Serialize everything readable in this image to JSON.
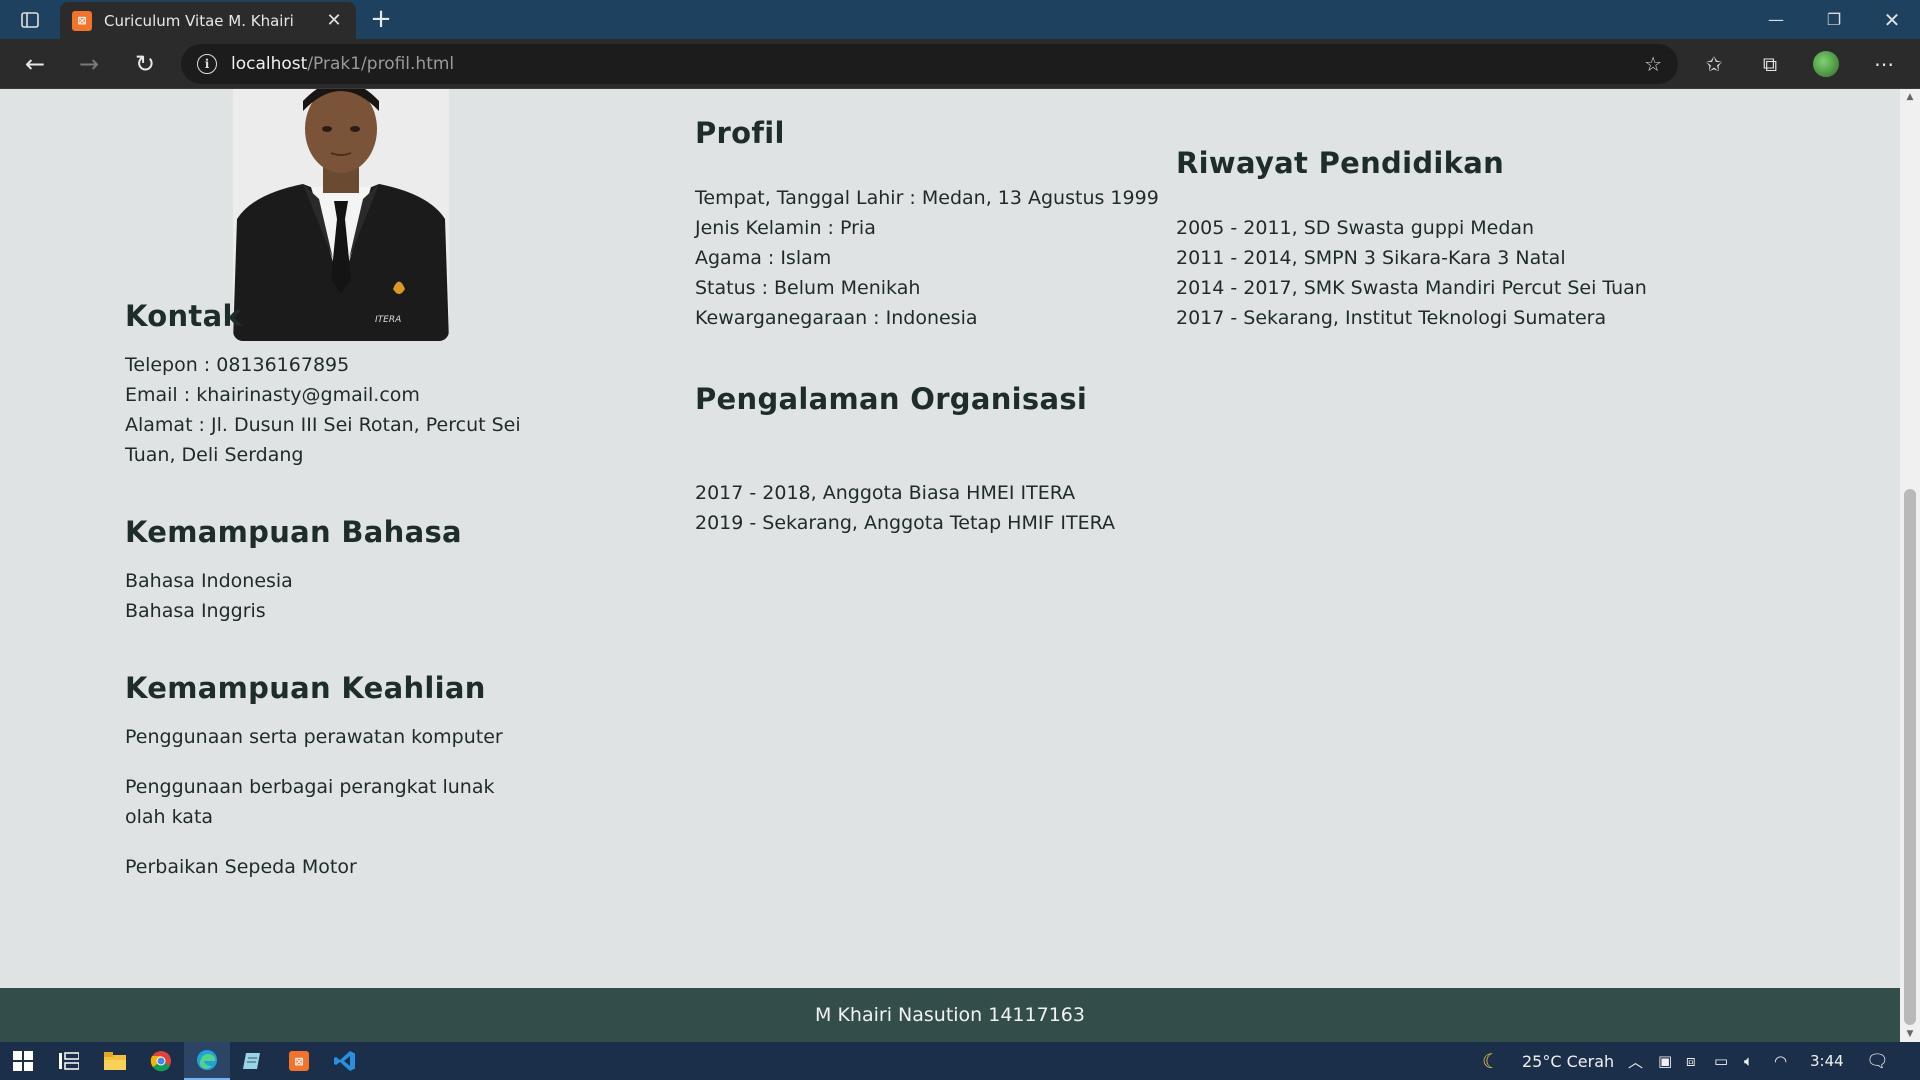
{
  "browser": {
    "tab_title": "Curiculum Vitae M. Khairi",
    "url_host": "localhost",
    "url_path": "/Prak1/profil.html"
  },
  "profile": {
    "heading": "Profil",
    "lines": [
      "Tempat, Tanggal Lahir : Medan, 13 Agustus 1999",
      "Jenis Kelamin : Pria",
      "Agama : Islam",
      "Status : Belum Menikah",
      "Kewarganegaraan : Indonesia"
    ]
  },
  "education": {
    "heading": "Riwayat Pendidikan",
    "lines": [
      "2005 - 2011, SD Swasta guppi Medan",
      "2011 - 2014, SMPN 3 Sikara-Kara 3 Natal",
      "2014 - 2017, SMK Swasta Mandiri Percut Sei Tuan",
      "2017 - Sekarang, Institut Teknologi Sumatera"
    ]
  },
  "organization": {
    "heading": "Pengalaman Organisasi",
    "lines": [
      "2017 - 2018, Anggota Biasa HMEI ITERA",
      "2019 - Sekarang, Anggota Tetap HMIF ITERA"
    ]
  },
  "contact": {
    "heading": "Kontak",
    "phone": "Telepon : 08136167895",
    "email": "Email : khairinasty@gmail.com",
    "address_1": "Alamat : Jl. Dusun III Sei Rotan, Percut Sei",
    "address_2": "Tuan, Deli Serdang"
  },
  "languages": {
    "heading": "Kemampuan Bahasa",
    "items": [
      "Bahasa Indonesia",
      "Bahasa Inggris"
    ]
  },
  "skills": {
    "heading": "Kemampuan Keahlian",
    "item_1": "Penggunaan serta perawatan komputer",
    "item_2_line1": "Penggunaan berbagai perangkat lunak",
    "item_2_line2": "olah kata",
    "item_3": "Perbaikan Sepeda Motor"
  },
  "footer": {
    "text": "M Khairi Nasution 14117163"
  },
  "photo": {
    "badge_text": "ITERA"
  },
  "taskbar": {
    "weather": "25°C Cerah",
    "time": "3:44"
  },
  "colors": {
    "page_bg": "#dfe3e3",
    "footer_bg": "#334e4a",
    "titlebar_bg": "#1e4160",
    "taskbar_bg": "#1b2f4a"
  }
}
